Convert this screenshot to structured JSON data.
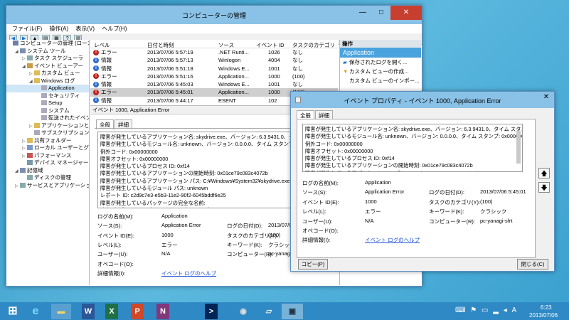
{
  "main_window": {
    "title": "コンピューターの管理",
    "menu": [
      "ファイル(F)",
      "操作(A)",
      "表示(V)",
      "ヘルプ(H)"
    ],
    "controls": {
      "minimize": "—",
      "maximize": "□",
      "close": "✕"
    }
  },
  "tree": [
    {
      "label": "コンピューターの管理 (ローカル)",
      "indent": 0,
      "exp": "",
      "color": "#6a7fa8"
    },
    {
      "label": "システム ツール",
      "indent": 1,
      "exp": "◢",
      "color": "#7b8fb0"
    },
    {
      "label": "タスク スケジューラ",
      "indent": 2,
      "exp": "▷",
      "color": "#8aa"
    },
    {
      "label": "イベント ビューアー",
      "indent": 2,
      "exp": "◢",
      "color": "#c94"
    },
    {
      "label": "カスタム ビュー",
      "indent": 3,
      "exp": "▷",
      "color": "#db5"
    },
    {
      "label": "Windows ログ",
      "indent": 3,
      "exp": "◢",
      "color": "#db5"
    },
    {
      "label": "Application",
      "indent": 4,
      "exp": "",
      "color": "#aab"
    },
    {
      "label": "セキュリティ",
      "indent": 4,
      "exp": "",
      "color": "#aab"
    },
    {
      "label": "Setup",
      "indent": 4,
      "exp": "",
      "color": "#aab"
    },
    {
      "label": "システム",
      "indent": 4,
      "exp": "",
      "color": "#aab"
    },
    {
      "label": "転送されたイベント",
      "indent": 4,
      "exp": "",
      "color": "#aab"
    },
    {
      "label": "アプリケーションとサービス",
      "indent": 3,
      "exp": "▷",
      "color": "#db5"
    },
    {
      "label": "サブスクリプション",
      "indent": 3,
      "exp": "",
      "color": "#aab"
    },
    {
      "label": "共有フォルダー",
      "indent": 2,
      "exp": "▷",
      "color": "#db5"
    },
    {
      "label": "ローカル ユーザーとグループ",
      "indent": 2,
      "exp": "▷",
      "color": "#79c"
    },
    {
      "label": "パフォーマンス",
      "indent": 2,
      "exp": "▷",
      "color": "#c55"
    },
    {
      "label": "デバイス マネージャー",
      "indent": 2,
      "exp": "",
      "color": "#79a"
    },
    {
      "label": "記憶域",
      "indent": 1,
      "exp": "◢",
      "color": "#7b8fb0"
    },
    {
      "label": "ディスクの管理",
      "indent": 2,
      "exp": "",
      "color": "#8aa"
    },
    {
      "label": "サービスとアプリケーション",
      "indent": 1,
      "exp": "▷",
      "color": "#8aa"
    }
  ],
  "list": {
    "headers": [
      "レベル",
      "日付と時刻",
      "ソース",
      "イベント ID",
      "タスクのカテゴリ"
    ],
    "rows": [
      {
        "level": "エラー",
        "type": "error",
        "date": "2013/07/06 5:57:19",
        "source": ".NET Runti...",
        "id": "1026",
        "cat": "なし"
      },
      {
        "level": "情報",
        "type": "info",
        "date": "2013/07/06 5:57:13",
        "source": "Winlogon",
        "id": "4004",
        "cat": "なし"
      },
      {
        "level": "情報",
        "type": "info",
        "date": "2013/07/06 5:51:18",
        "source": "Windows E...",
        "id": "1001",
        "cat": "なし"
      },
      {
        "level": "エラー",
        "type": "error",
        "date": "2013/07/06 5:51:16",
        "source": "Application...",
        "id": "1000",
        "cat": "(100)"
      },
      {
        "level": "情報",
        "type": "info",
        "date": "2013/07/06 5:45:03",
        "source": "Windows E...",
        "id": "1001",
        "cat": "なし"
      },
      {
        "level": "エラー",
        "type": "error",
        "date": "2013/07/06 5:45:01",
        "source": "Application...",
        "id": "1000",
        "cat": "(100)",
        "sel": true
      },
      {
        "level": "情報",
        "type": "info",
        "date": "2013/07/06 5:44:17",
        "source": "ESENT",
        "id": "102",
        "cat": "..."
      }
    ]
  },
  "detail": {
    "header": "イベント 1000, Application Error",
    "tabs": [
      "全般",
      "詳細"
    ],
    "message": [
      "障害が発生しているアプリケーション名: skydrive.exe、バージョン: 6.3.9431.0、タイム スタンプ: 0x5",
      "障害が発生しているモジュール名: unknown、バージョン: 0.0.0.0、タイム スタンプ: 0x00000000",
      "例外コード: 0x00000000",
      "障害オフセット: 0x00000000",
      "障害が発生しているプロセス ID: 0xf14",
      "障害が発生しているアプリケーションの開始時刻: 0x01ce79c083c4072b",
      "障害が発生しているアプリケーション パス: C:¥Windows¥System32¥skydrive.exe",
      "障害が発生しているモジュール パス: unknown",
      "レポート ID: c2d9c7e3-e5b3-11e2-90f2-6045bddf6e25",
      "障害が発生しているパッケージの完全な名前:",
      "障害が発生しているパッケージに関連するアプリケーション ID:"
    ],
    "fields": {
      "log_name_label": "ログの名前(M):",
      "log_name": "Application",
      "source_label": "ソース(S):",
      "source": "Application Error",
      "logged_label": "ログの日付(D):",
      "logged": "2013/07/06",
      "event_id_label": "イベント ID(E):",
      "event_id": "1000",
      "task_label": "タスクのカテゴリ(Y):",
      "task": "(100)",
      "level_label": "レベル(L):",
      "level": "エラー",
      "keywords_label": "キーワード(K):",
      "keywords": "クラシック",
      "user_label": "ユーザー(U):",
      "user": "N/A",
      "computer_label": "コンピューター(R):",
      "computer": "pc-yanagi-s",
      "opcode_label": "オペコード(O):",
      "more_label": "詳細情報(I):",
      "more_link": "イベント ログのヘルプ"
    }
  },
  "actions": {
    "header": "操作",
    "selected": "Application",
    "items": [
      "保存されたログを開く...",
      "カスタム ビューの作成...",
      "カスタム ビューのインポー..."
    ]
  },
  "dialog": {
    "title": "イベント プロパティ - イベント 1000, Application Error",
    "tabs": [
      "全般",
      "詳細"
    ],
    "message": [
      "障害が発生しているアプリケーション名: skydrive.exe、バージョン: 6.3.9431.0、タイム スタンプ: 0x51bcd719",
      "障害が発生しているモジュール名: unknown、バージョン: 0.0.0.0、タイム スタンプ: 0x00000000",
      "例外コード: 0x00000000",
      "障害オフセット: 0x00000000",
      "障害が発生しているプロセス ID: 0xf14",
      "障害が発生しているアプリケーションの開始時刻: 0x01ce79c083c4072b",
      "障害が発生しているアプリケーション パス: C:¥Windows¥System32¥skydrive.exe"
    ],
    "fields": {
      "log_name_label": "ログの名前(M):",
      "log_name": "Application",
      "source_label": "ソース(S):",
      "source": "Application Error",
      "logged_label": "ログの日付(D):",
      "logged": "2013/07/06 5:45:01",
      "event_id_label": "イベント ID(E):",
      "event_id": "1000",
      "task_label": "タスクのカテゴリ(Y):",
      "task": "(100)",
      "level_label": "レベル(L):",
      "level": "エラー",
      "keywords_label": "キーワード(K):",
      "keywords": "クラシック",
      "user_label": "ユーザー(U):",
      "user": "N/A",
      "computer_label": "コンピューター(R):",
      "computer": "pc-yanagi-sfrt",
      "opcode_label": "オペコード(O):",
      "more_label": "詳細情報(I):",
      "more_link": "イベント ログのヘルプ"
    },
    "copy_button": "コピー(P)",
    "close_button": "閉じる(C)",
    "close_icon": "✕",
    "up_arrow": "🡅",
    "down_arrow": "🡇"
  },
  "taskbar": {
    "time": "6:23",
    "date": "2013/07/06",
    "ime": "A",
    "apps": [
      "IE",
      "Explorer",
      "Word",
      "Excel",
      "PowerPoint",
      "OneNote",
      "PowerShell",
      "Tool",
      "Notepad",
      "Computer Management"
    ]
  }
}
